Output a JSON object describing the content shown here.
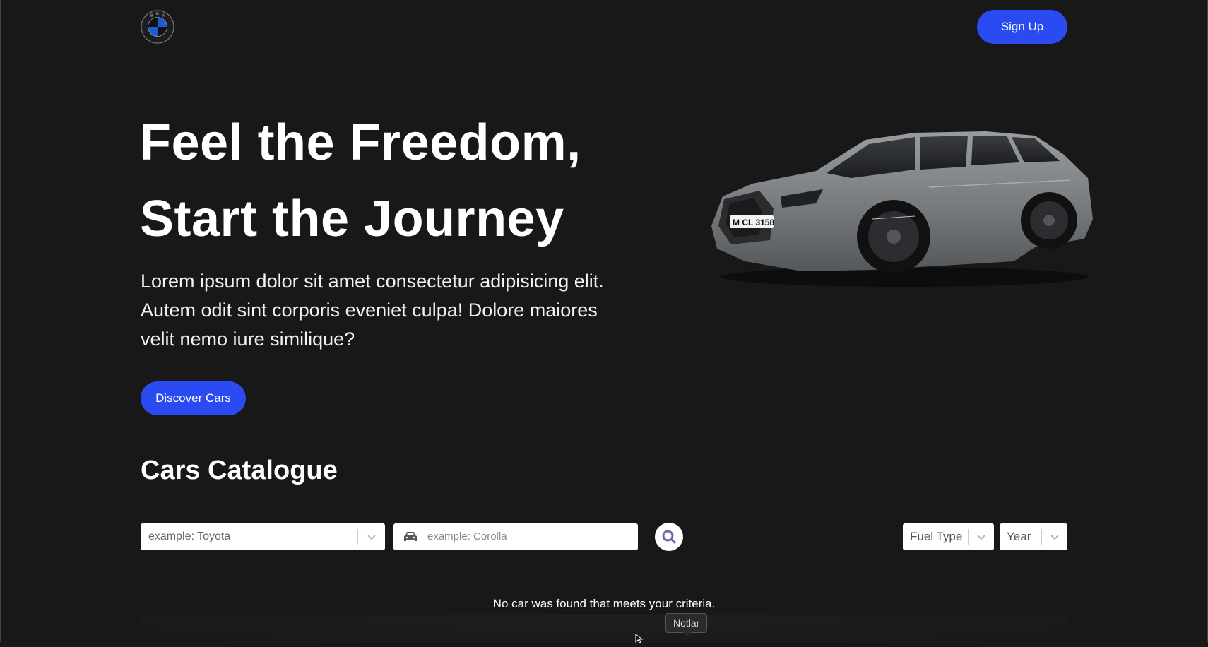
{
  "nav": {
    "logo_name": "BMW",
    "logo_letters": [
      "B",
      "M",
      "W"
    ],
    "signup_label": "Sign Up"
  },
  "hero": {
    "title_line1": "Feel the Freedom,",
    "title_line2": "Start the Journey",
    "subtitle": "Lorem ipsum dolor sit amet consectetur adipisicing elit. Autem odit sint corporis eveniet culpa! Dolore maiores velit nemo iure similique?",
    "cta_label": "Discover Cars",
    "plate_text": "M CL 3158"
  },
  "catalogue": {
    "title": "Cars Catalogue",
    "make_placeholder": "example: Toyota",
    "model_placeholder": "example: Corolla",
    "filters": {
      "fuel_label": "Fuel Type",
      "year_label": "Year"
    },
    "empty_message": "No car was found that meets your criteria."
  },
  "tooltip": {
    "text": "Notlar"
  },
  "colors": {
    "background": "#181819",
    "accent": "#2b4bf2",
    "search_icon": "#6e6aa8"
  },
  "icons": [
    "bmw-logo",
    "chevron-down-icon",
    "car-icon",
    "search-icon",
    "mouse-cursor-icon"
  ]
}
